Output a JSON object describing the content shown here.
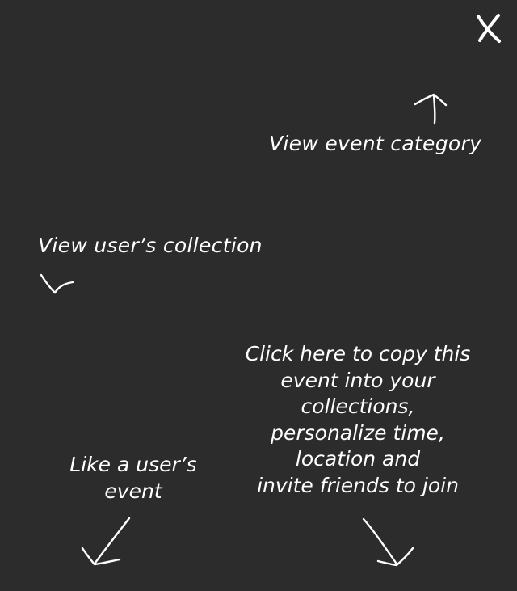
{
  "close": {
    "label": "Close",
    "icon": "close-icon"
  },
  "hints": {
    "category": "View event category",
    "collection": "View user’s collection",
    "copy_lines": [
      "Click here to copy this",
      "event into your",
      "collections,",
      "personalize time,",
      "location and",
      "invite friends to join"
    ],
    "like_lines": [
      "Like a user’s",
      "event"
    ]
  },
  "colors": {
    "background": "#2c2c2c",
    "text": "#ffffff"
  }
}
